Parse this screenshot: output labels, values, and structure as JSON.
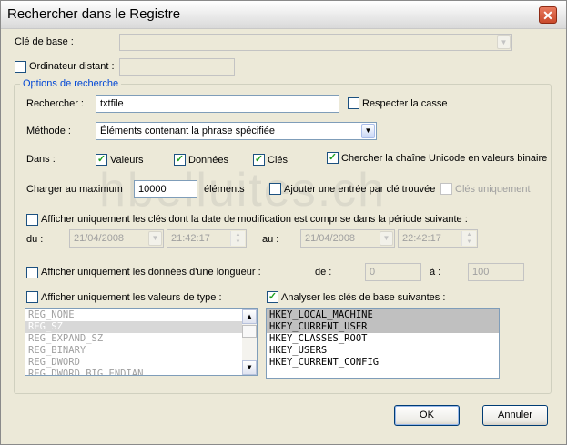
{
  "window": {
    "title": "Rechercher dans le Registre",
    "close_glyph": "✕"
  },
  "base_key": {
    "label": "Clé de base :",
    "value": ""
  },
  "remote": {
    "label": "Ordinateur distant :",
    "checked": false,
    "value": ""
  },
  "group": {
    "title": "Options de recherche"
  },
  "search": {
    "label": "Rechercher :",
    "value": "txtfile",
    "match_case_label": "Respecter la casse",
    "match_case_checked": false
  },
  "method": {
    "label": "Méthode :",
    "value": "Éléments contenant la phrase spécifiée"
  },
  "in": {
    "label": "Dans :",
    "values_label": "Valeurs",
    "values_checked": true,
    "data_label": "Données",
    "data_checked": true,
    "keys_label": "Clés",
    "keys_checked": true,
    "unicode_label": "Chercher la chaîne Unicode en valeurs binaire",
    "unicode_checked": true
  },
  "max": {
    "label": "Charger au maximum",
    "value": "10000",
    "unit": "éléments",
    "one_entry_label": "Ajouter une entrée par clé trouvée",
    "one_entry_checked": false,
    "keys_only_label": "Clés uniquement",
    "keys_only_checked": false
  },
  "date": {
    "label": "Afficher uniquement les clés dont la date de modification est comprise dans la période suivante :",
    "checked": false,
    "from_label": "du :",
    "from_date": "21/04/2008",
    "from_time": "21:42:17",
    "to_label": "au :",
    "to_date": "21/04/2008",
    "to_time": "22:42:17"
  },
  "length": {
    "label": "Afficher uniquement les données d'une longueur :",
    "checked": false,
    "from_label": "de :",
    "from_value": "0",
    "to_label": "à :",
    "to_value": "100"
  },
  "types": {
    "label": "Afficher uniquement les valeurs de type :",
    "checked": false,
    "items": [
      "REG_NONE",
      "REG_SZ",
      "REG_EXPAND_SZ",
      "REG_BINARY",
      "REG_DWORD",
      "REG_DWORD_BIG_ENDIAN"
    ],
    "selected": [
      "REG_SZ"
    ]
  },
  "base_keys": {
    "label": "Analyser les clés de base suivantes :",
    "checked": true,
    "items": [
      "HKEY_LOCAL_MACHINE",
      "HKEY_CURRENT_USER",
      "HKEY_CLASSES_ROOT",
      "HKEY_USERS",
      "HKEY_CURRENT_CONFIG"
    ],
    "selected": [
      "HKEY_LOCAL_MACHINE",
      "HKEY_CURRENT_USER"
    ]
  },
  "buttons": {
    "ok": "OK",
    "cancel": "Annuler"
  },
  "watermark": "hbelluites.ch",
  "icons": {
    "dropdown": "▼",
    "spin_up": "▲",
    "spin_down": "▼",
    "check": "✓"
  },
  "colors": {
    "group_title": "#0046d5",
    "check": "#21a121",
    "close": "#c94a2c"
  }
}
